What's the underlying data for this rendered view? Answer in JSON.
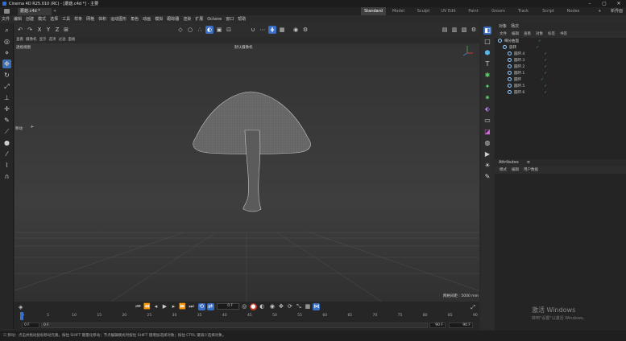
{
  "window": {
    "title": "Cinema 4D R25.010 (RC) - [蘑菇.c4d *] - 主要"
  },
  "tabs": {
    "doc_tab": "蘑菇.c4d *",
    "layouts": [
      "Standard",
      "Model",
      "Sculpt",
      "UV Edit",
      "Paint",
      "Groom",
      "Track",
      "Script",
      "Nodes"
    ],
    "active_layout": "Standard",
    "new_layout": "新界面"
  },
  "menubar": [
    "文件",
    "编辑",
    "创建",
    "模式",
    "选择",
    "工具",
    "样条",
    "网格",
    "体积",
    "运动图形",
    "角色",
    "动画",
    "模拟",
    "跟踪器",
    "渲染",
    "扩展",
    "Octane",
    "窗口",
    "帮助"
  ],
  "viewport": {
    "menu": [
      "查看",
      "摄像机",
      "显示",
      "选项",
      "过滤",
      "面板"
    ],
    "name": "透视视图",
    "camera": "默认摄像机",
    "move_label": "移动",
    "grid_info": "网格间距 : 5000 mm"
  },
  "timeline": {
    "current_frame": "0 F",
    "ticks": [
      "0",
      "5",
      "10",
      "15",
      "20",
      "25",
      "30",
      "35",
      "40",
      "45",
      "50",
      "55",
      "60",
      "65",
      "70",
      "75",
      "80",
      "85",
      "90"
    ],
    "start_a": "0 F",
    "start_b": "0 F",
    "end_a": "90 F",
    "end_b": "90 F"
  },
  "object_manager": {
    "tabs": [
      "对象",
      "场次"
    ],
    "menu": [
      "文件",
      "编辑",
      "查看",
      "对象",
      "标签",
      "书签"
    ],
    "objects": [
      {
        "name": "细分曲面",
        "indent": 0
      },
      {
        "name": "旋转",
        "indent": 1
      },
      {
        "name": "圆环.4",
        "indent": 2
      },
      {
        "name": "圆环.3",
        "indent": 2
      },
      {
        "name": "圆环.2",
        "indent": 2
      },
      {
        "name": "圆环.1",
        "indent": 2
      },
      {
        "name": "圆环",
        "indent": 2
      },
      {
        "name": "圆环.5",
        "indent": 2
      },
      {
        "name": "圆环.6",
        "indent": 2
      }
    ]
  },
  "attributes": {
    "title": "Attributes",
    "menu": [
      "模式",
      "编辑",
      "用户数据"
    ]
  },
  "statusbar": {
    "text": "移动：点击并拖动鼠标移动元素。按住 SHIFT 键量化移动；节点编辑模式时按住 SHIFT 键增加选择对象；按住 CTRL 键减少选择对象。"
  },
  "watermark": {
    "line1": "激活 Windows",
    "line2": "转到\"设置\"以激活 Windows。"
  },
  "colors": {
    "accent": "#3a6fc4",
    "viewport_bg": "#3a3a3a",
    "panel_bg": "#242424"
  }
}
